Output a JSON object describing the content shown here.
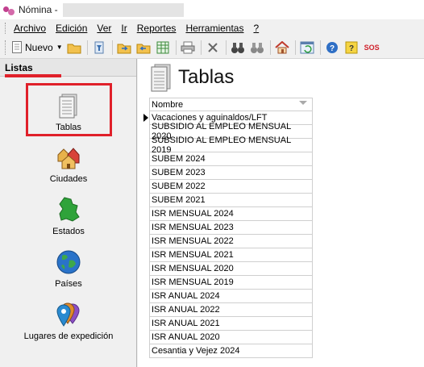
{
  "window": {
    "title": "Nómina - "
  },
  "menu": [
    "Archivo",
    "Edición",
    "Ver",
    "Ir",
    "Reportes",
    "Herramientas",
    "?"
  ],
  "toolbar": {
    "nuevo_label": "Nuevo",
    "sos_label": "SOS"
  },
  "left_panel": {
    "header": "Listas",
    "items": [
      {
        "label": "Tablas",
        "icon": "document-table-icon"
      },
      {
        "label": "Ciudades",
        "icon": "city-houses-icon"
      },
      {
        "label": "Estados",
        "icon": "state-map-icon"
      },
      {
        "label": "Países",
        "icon": "globe-icon"
      },
      {
        "label": "Lugares de expedición",
        "icon": "location-pins-icon"
      }
    ]
  },
  "main": {
    "title": "Tablas",
    "grid": {
      "column": "Nombre",
      "rows": [
        "Vacaciones y aguinaldos/LFT",
        "SUBSIDIO AL EMPLEO MENSUAL 2020",
        "SUBSIDIO AL EMPLEO MENSUAL 2019",
        "SUBEM 2024",
        "SUBEM 2023",
        "SUBEM 2022",
        "SUBEM 2021",
        "ISR MENSUAL 2024",
        "ISR MENSUAL 2023",
        "ISR MENSUAL 2022",
        "ISR MENSUAL 2021",
        "ISR MENSUAL 2020",
        "ISR MENSUAL 2019",
        "ISR ANUAL 2024",
        "ISR ANUAL 2022",
        "ISR ANUAL 2021",
        "ISR ANUAL 2020",
        "Cesantia y Vejez 2024"
      ]
    }
  },
  "colors": {
    "highlight": "#e0202a",
    "panel_bg": "#f0f0f0"
  }
}
